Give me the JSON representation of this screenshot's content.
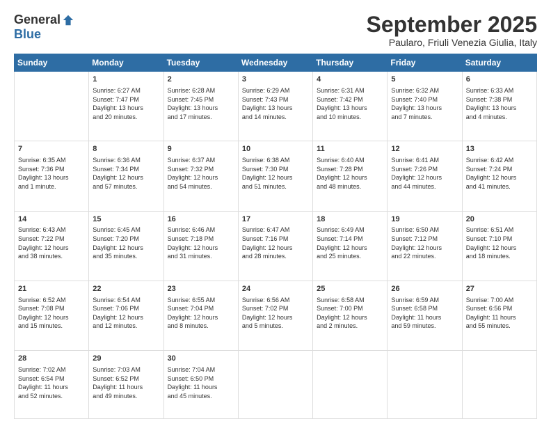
{
  "logo": {
    "general": "General",
    "blue": "Blue"
  },
  "header": {
    "month": "September 2025",
    "location": "Paularo, Friuli Venezia Giulia, Italy"
  },
  "weekdays": [
    "Sunday",
    "Monday",
    "Tuesday",
    "Wednesday",
    "Thursday",
    "Friday",
    "Saturday"
  ],
  "weeks": [
    [
      {
        "day": "",
        "info": ""
      },
      {
        "day": "1",
        "info": "Sunrise: 6:27 AM\nSunset: 7:47 PM\nDaylight: 13 hours\nand 20 minutes."
      },
      {
        "day": "2",
        "info": "Sunrise: 6:28 AM\nSunset: 7:45 PM\nDaylight: 13 hours\nand 17 minutes."
      },
      {
        "day": "3",
        "info": "Sunrise: 6:29 AM\nSunset: 7:43 PM\nDaylight: 13 hours\nand 14 minutes."
      },
      {
        "day": "4",
        "info": "Sunrise: 6:31 AM\nSunset: 7:42 PM\nDaylight: 13 hours\nand 10 minutes."
      },
      {
        "day": "5",
        "info": "Sunrise: 6:32 AM\nSunset: 7:40 PM\nDaylight: 13 hours\nand 7 minutes."
      },
      {
        "day": "6",
        "info": "Sunrise: 6:33 AM\nSunset: 7:38 PM\nDaylight: 13 hours\nand 4 minutes."
      }
    ],
    [
      {
        "day": "7",
        "info": "Sunrise: 6:35 AM\nSunset: 7:36 PM\nDaylight: 13 hours\nand 1 minute."
      },
      {
        "day": "8",
        "info": "Sunrise: 6:36 AM\nSunset: 7:34 PM\nDaylight: 12 hours\nand 57 minutes."
      },
      {
        "day": "9",
        "info": "Sunrise: 6:37 AM\nSunset: 7:32 PM\nDaylight: 12 hours\nand 54 minutes."
      },
      {
        "day": "10",
        "info": "Sunrise: 6:38 AM\nSunset: 7:30 PM\nDaylight: 12 hours\nand 51 minutes."
      },
      {
        "day": "11",
        "info": "Sunrise: 6:40 AM\nSunset: 7:28 PM\nDaylight: 12 hours\nand 48 minutes."
      },
      {
        "day": "12",
        "info": "Sunrise: 6:41 AM\nSunset: 7:26 PM\nDaylight: 12 hours\nand 44 minutes."
      },
      {
        "day": "13",
        "info": "Sunrise: 6:42 AM\nSunset: 7:24 PM\nDaylight: 12 hours\nand 41 minutes."
      }
    ],
    [
      {
        "day": "14",
        "info": "Sunrise: 6:43 AM\nSunset: 7:22 PM\nDaylight: 12 hours\nand 38 minutes."
      },
      {
        "day": "15",
        "info": "Sunrise: 6:45 AM\nSunset: 7:20 PM\nDaylight: 12 hours\nand 35 minutes."
      },
      {
        "day": "16",
        "info": "Sunrise: 6:46 AM\nSunset: 7:18 PM\nDaylight: 12 hours\nand 31 minutes."
      },
      {
        "day": "17",
        "info": "Sunrise: 6:47 AM\nSunset: 7:16 PM\nDaylight: 12 hours\nand 28 minutes."
      },
      {
        "day": "18",
        "info": "Sunrise: 6:49 AM\nSunset: 7:14 PM\nDaylight: 12 hours\nand 25 minutes."
      },
      {
        "day": "19",
        "info": "Sunrise: 6:50 AM\nSunset: 7:12 PM\nDaylight: 12 hours\nand 22 minutes."
      },
      {
        "day": "20",
        "info": "Sunrise: 6:51 AM\nSunset: 7:10 PM\nDaylight: 12 hours\nand 18 minutes."
      }
    ],
    [
      {
        "day": "21",
        "info": "Sunrise: 6:52 AM\nSunset: 7:08 PM\nDaylight: 12 hours\nand 15 minutes."
      },
      {
        "day": "22",
        "info": "Sunrise: 6:54 AM\nSunset: 7:06 PM\nDaylight: 12 hours\nand 12 minutes."
      },
      {
        "day": "23",
        "info": "Sunrise: 6:55 AM\nSunset: 7:04 PM\nDaylight: 12 hours\nand 8 minutes."
      },
      {
        "day": "24",
        "info": "Sunrise: 6:56 AM\nSunset: 7:02 PM\nDaylight: 12 hours\nand 5 minutes."
      },
      {
        "day": "25",
        "info": "Sunrise: 6:58 AM\nSunset: 7:00 PM\nDaylight: 12 hours\nand 2 minutes."
      },
      {
        "day": "26",
        "info": "Sunrise: 6:59 AM\nSunset: 6:58 PM\nDaylight: 11 hours\nand 59 minutes."
      },
      {
        "day": "27",
        "info": "Sunrise: 7:00 AM\nSunset: 6:56 PM\nDaylight: 11 hours\nand 55 minutes."
      }
    ],
    [
      {
        "day": "28",
        "info": "Sunrise: 7:02 AM\nSunset: 6:54 PM\nDaylight: 11 hours\nand 52 minutes."
      },
      {
        "day": "29",
        "info": "Sunrise: 7:03 AM\nSunset: 6:52 PM\nDaylight: 11 hours\nand 49 minutes."
      },
      {
        "day": "30",
        "info": "Sunrise: 7:04 AM\nSunset: 6:50 PM\nDaylight: 11 hours\nand 45 minutes."
      },
      {
        "day": "",
        "info": ""
      },
      {
        "day": "",
        "info": ""
      },
      {
        "day": "",
        "info": ""
      },
      {
        "day": "",
        "info": ""
      }
    ]
  ]
}
